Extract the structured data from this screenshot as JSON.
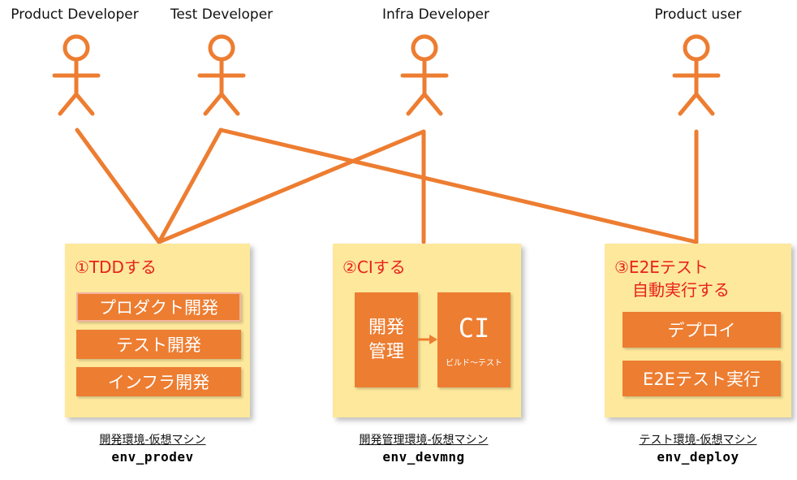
{
  "actors": [
    {
      "id": "product-developer",
      "label": "Product Developer"
    },
    {
      "id": "test-developer",
      "label": "Test Developer"
    },
    {
      "id": "infra-developer",
      "label": "Infra Developer"
    },
    {
      "id": "product-user",
      "label": "Product user"
    }
  ],
  "boxes": {
    "prodev": {
      "title": "①TDDする",
      "items": [
        "プロダクト開発",
        "テスト開発",
        "インフラ開発"
      ],
      "caption": "開発環境-仮想マシン",
      "env_name": "env_prodev"
    },
    "devmng": {
      "title": "②CIする",
      "left_block": {
        "line1": "開発",
        "line2": "管理"
      },
      "right_block": {
        "title": "CI",
        "subtitle": "ビルド〜テスト"
      },
      "caption": "開発管理環境-仮想マシン",
      "env_name": "env_devmng"
    },
    "deploy": {
      "title_line1": "③E2Eテスト",
      "title_line2": "自動実行する",
      "items": [
        "デプロイ",
        "E2Eテスト実行"
      ],
      "caption": "テスト環境-仮想マシン",
      "env_name": "env_deploy"
    }
  },
  "colors": {
    "accent": "#ed7d31",
    "box_fill": "#fde89b",
    "title_red": "#e8211d"
  }
}
